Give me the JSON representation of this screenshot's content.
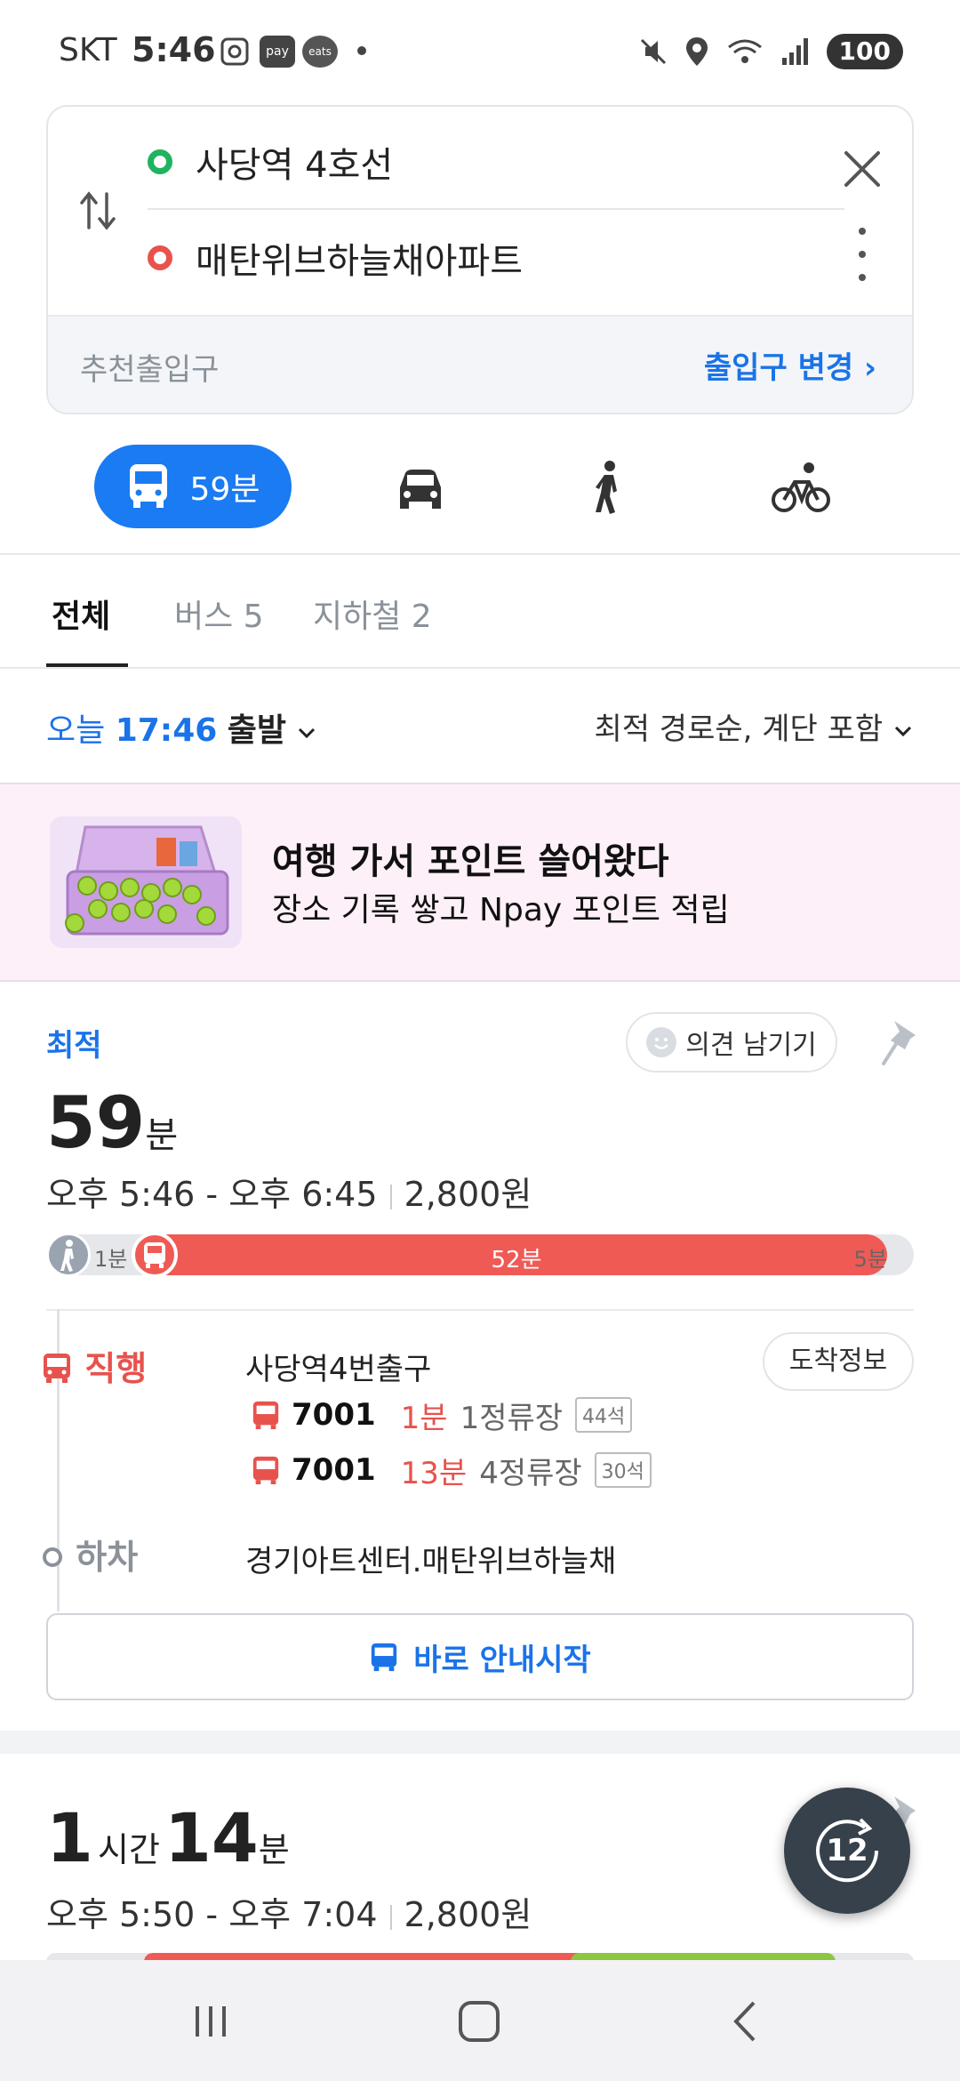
{
  "status_bar": {
    "carrier": "SKT",
    "time": "5:46",
    "pay_label": "pay",
    "eats_label": "eats",
    "battery": "100"
  },
  "route": {
    "origin": "사당역 4호선",
    "destination": "매탄위브하늘채아파트",
    "recommended_exit_label": "추천출입구",
    "change_exit_label": "출입구 변경 ›",
    "origin_color": "#1fb35f",
    "destination_color": "#e8524d"
  },
  "modes": {
    "transit_time": "59분",
    "icons": [
      "bus-icon",
      "car-icon",
      "walk-icon",
      "bicycle-icon"
    ]
  },
  "tabs": [
    {
      "label": "전체",
      "active": true
    },
    {
      "label": "버스 5",
      "active": false
    },
    {
      "label": "지하철 2",
      "active": false
    }
  ],
  "departure": {
    "day": "오늘",
    "time": "17:46",
    "action": "출발",
    "sort": "최적 경로순, 계단 포함"
  },
  "ad": {
    "title": "여행 가서 포인트 쓸어왔다",
    "subtitle": "장소 기록 쌓고 Npay 포인트 적립"
  },
  "result1": {
    "badge": "최적",
    "feedback": "의견 남기기",
    "duration_num": "59",
    "duration_unit": "분",
    "time_range": "오후 5:46 - 오후 6:45",
    "fare": "2,800원",
    "walk_before": "1분",
    "bus_ride": "52분",
    "walk_after": "5분",
    "board_kind": "직행",
    "board_stop": "사당역4번출구",
    "arrive_info": "도착정보",
    "buses": [
      {
        "number": "7001",
        "eta": "1분",
        "stops": "1정류장",
        "seats": "44석"
      },
      {
        "number": "7001",
        "eta": "13분",
        "stops": "4정류장",
        "seats": "30석"
      }
    ],
    "alight_kind": "하차",
    "alight_stop": "경기아트센터.매탄위브하늘채",
    "start_guide": "바로 안내시작"
  },
  "result2": {
    "hours_num": "1",
    "hours_unit": "시간",
    "min_num": "14",
    "min_unit": "분",
    "time_range": "오후 5:50 - 오후 7:04",
    "fare": "2,800원"
  },
  "fab": {
    "label": "12"
  },
  "colors": {
    "accent": "#1a7bf2",
    "bus": "#f05a55",
    "subway_green": "#8dc63f"
  }
}
